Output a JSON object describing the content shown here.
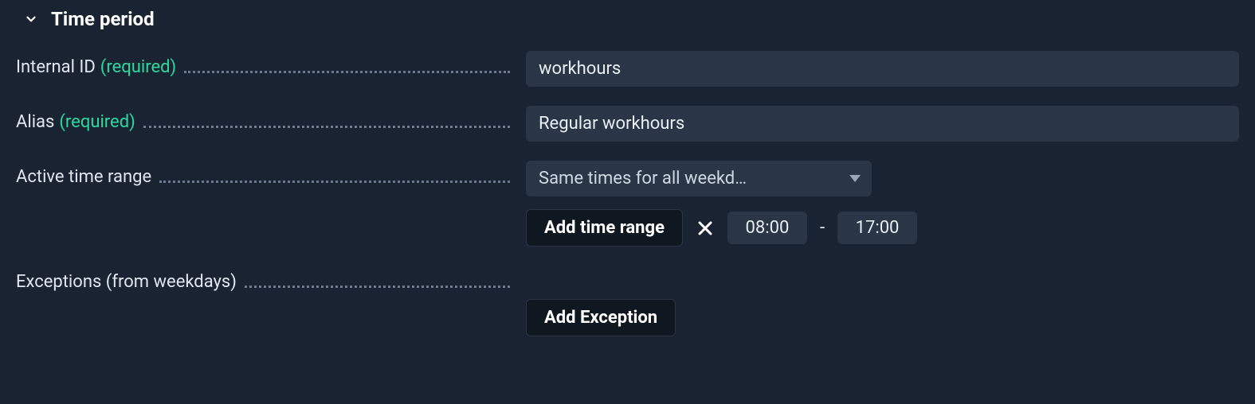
{
  "section": {
    "title": "Time period"
  },
  "fields": {
    "internal_id": {
      "label": "Internal ID",
      "required_text": "(required)",
      "value": "workhours"
    },
    "alias": {
      "label": "Alias",
      "required_text": "(required)",
      "value": "Regular workhours"
    },
    "active_time_range": {
      "label": "Active time range",
      "select_display": "Same times for all weekd…",
      "add_button": "Add time range",
      "time_from": "08:00",
      "time_separator": "-",
      "time_to": "17:00"
    },
    "exceptions": {
      "label": "Exceptions (from weekdays)",
      "add_button": "Add Exception"
    }
  }
}
